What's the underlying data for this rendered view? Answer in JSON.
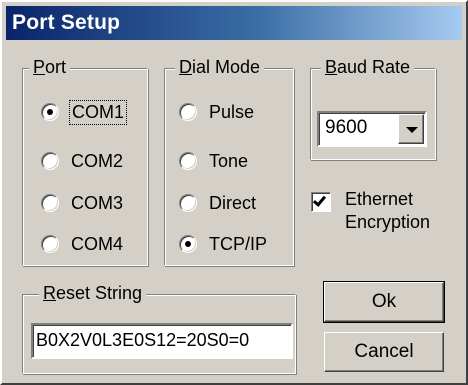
{
  "window": {
    "title": "Port Setup"
  },
  "port_group": {
    "legend_underlined": "P",
    "legend_rest": "ort",
    "options": [
      {
        "label": "COM1",
        "checked": true
      },
      {
        "label": "COM2",
        "checked": false
      },
      {
        "label": "COM3",
        "checked": false
      },
      {
        "label": "COM4",
        "checked": false
      }
    ]
  },
  "dial_group": {
    "legend_underlined": "D",
    "legend_rest": "ial Mode",
    "options": [
      {
        "label": "Pulse",
        "checked": false
      },
      {
        "label": "Tone",
        "checked": false
      },
      {
        "label": "Direct",
        "checked": false
      },
      {
        "label": "TCP/IP",
        "checked": true
      }
    ]
  },
  "baud_group": {
    "legend_underlined": "B",
    "legend_rest": "aud Rate",
    "selected": "9600"
  },
  "ethernet": {
    "label_line1": "Ethernet",
    "label_line2": "Encryption",
    "checked": true
  },
  "reset_group": {
    "legend_underlined": "R",
    "legend_rest": "eset String",
    "value": "B0X2V0L3E0S12=20S0=0"
  },
  "buttons": {
    "ok_label": "Ok",
    "cancel_label": "Cancel"
  }
}
